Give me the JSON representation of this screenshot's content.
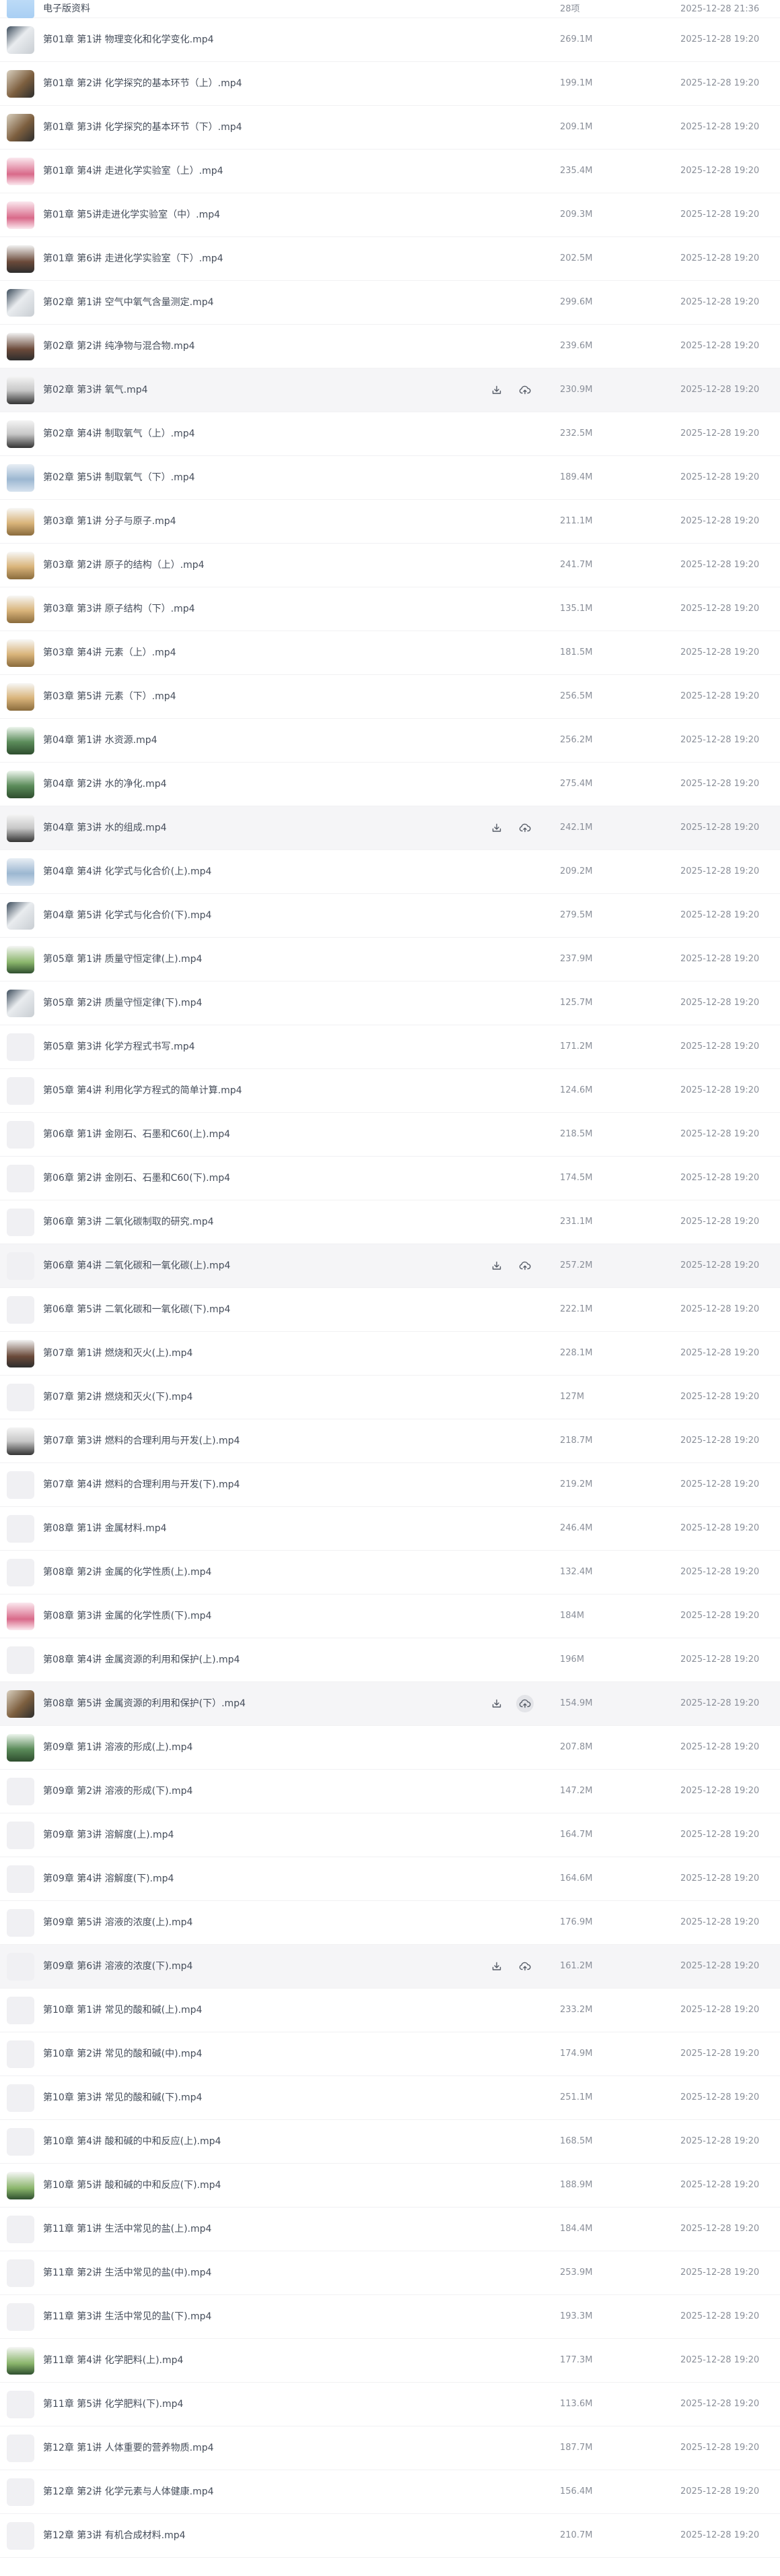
{
  "files": [
    {
      "name": "电子版资料",
      "size": "28项",
      "date": "2025-12-28 21:36",
      "thumb": "t-folder"
    },
    {
      "name": "第01章 第1讲 物理变化和化学变化.mp4",
      "size": "269.1M",
      "date": "2025-12-28 19:20",
      "thumb": "t-video-a"
    },
    {
      "name": "第01章 第2讲 化学探究的基本环节（上）.mp4",
      "size": "199.1M",
      "date": "2025-12-28 19:20",
      "thumb": "t-video-h"
    },
    {
      "name": "第01章 第3讲 化学探究的基本环节（下）.mp4",
      "size": "209.1M",
      "date": "2025-12-28 19:20",
      "thumb": "t-video-h"
    },
    {
      "name": "第01章 第4讲 走进化学实验室（上）.mp4",
      "size": "235.4M",
      "date": "2025-12-28 19:20",
      "thumb": "t-video-g"
    },
    {
      "name": "第01章 第5讲走进化学实验室（中）.mp4",
      "size": "209.3M",
      "date": "2025-12-28 19:20",
      "thumb": "t-video-g"
    },
    {
      "name": "第01章 第6讲 走进化学实验室（下）.mp4",
      "size": "202.5M",
      "date": "2025-12-28 19:20",
      "thumb": "t-video-b"
    },
    {
      "name": "第02章 第1讲 空气中氧气含量测定.mp4",
      "size": "299.6M",
      "date": "2025-12-28 19:20",
      "thumb": "t-video-a"
    },
    {
      "name": "第02章 第2讲 纯净物与混合物.mp4",
      "size": "239.6M",
      "date": "2025-12-28 19:20",
      "thumb": "t-video-b"
    },
    {
      "name": "第02章 第3讲 氧气.mp4",
      "size": "230.9M",
      "date": "2025-12-28 19:20",
      "thumb": "t-video-f"
    },
    {
      "name": "第02章 第4讲 制取氧气（上）.mp4",
      "size": "232.5M",
      "date": "2025-12-28 19:20",
      "thumb": "t-video-f"
    },
    {
      "name": "第02章 第5讲 制取氧气（下）.mp4",
      "size": "189.4M",
      "date": "2025-12-28 19:20",
      "thumb": "t-video-c"
    },
    {
      "name": "第03章 第1讲 分子与原子.mp4",
      "size": "211.1M",
      "date": "2025-12-28 19:20",
      "thumb": "t-video-d"
    },
    {
      "name": "第03章 第2讲 原子的结构（上）.mp4",
      "size": "241.7M",
      "date": "2025-12-28 19:20",
      "thumb": "t-video-d"
    },
    {
      "name": "第03章 第3讲 原子结构（下）.mp4",
      "size": "135.1M",
      "date": "2025-12-28 19:20",
      "thumb": "t-video-d"
    },
    {
      "name": "第03章 第4讲 元素（上）.mp4",
      "size": "181.5M",
      "date": "2025-12-28 19:20",
      "thumb": "t-video-d"
    },
    {
      "name": "第03章 第5讲 元素（下）.mp4",
      "size": "256.5M",
      "date": "2025-12-28 19:20",
      "thumb": "t-video-d"
    },
    {
      "name": "第04章 第1讲 水资源.mp4",
      "size": "256.2M",
      "date": "2025-12-28 19:20",
      "thumb": "t-video-e"
    },
    {
      "name": "第04章 第2讲 水的净化.mp4",
      "size": "275.4M",
      "date": "2025-12-28 19:20",
      "thumb": "t-video-e"
    },
    {
      "name": "第04章 第3讲 水的组成.mp4",
      "size": "242.1M",
      "date": "2025-12-28 19:20",
      "thumb": "t-video-f"
    },
    {
      "name": "第04章 第4讲 化学式与化合价(上).mp4",
      "size": "209.2M",
      "date": "2025-12-28 19:20",
      "thumb": "t-video-c"
    },
    {
      "name": "第04章 第5讲 化学式与化合价(下).mp4",
      "size": "279.5M",
      "date": "2025-12-28 19:20",
      "thumb": "t-video-a"
    },
    {
      "name": "第05章 第1讲 质量守恒定律(上).mp4",
      "size": "237.9M",
      "date": "2025-12-28 19:20",
      "thumb": "t-video-i"
    },
    {
      "name": "第05章 第2讲 质量守恒定律(下).mp4",
      "size": "125.7M",
      "date": "2025-12-28 19:20",
      "thumb": "t-video-a"
    },
    {
      "name": "第05章 第3讲 化学方程式书写.mp4",
      "size": "171.2M",
      "date": "2025-12-28 19:20",
      "thumb": "t-blank"
    },
    {
      "name": "第05章 第4讲 利用化学方程式的简单计算.mp4",
      "size": "124.6M",
      "date": "2025-12-28 19:20",
      "thumb": "t-blank"
    },
    {
      "name": "第06章 第1讲 金刚石、石墨和C60(上).mp4",
      "size": "218.5M",
      "date": "2025-12-28 19:20",
      "thumb": "t-blank"
    },
    {
      "name": "第06章 第2讲 金刚石、石墨和C60(下).mp4",
      "size": "174.5M",
      "date": "2025-12-28 19:20",
      "thumb": "t-blank"
    },
    {
      "name": "第06章 第3讲 二氧化碳制取的研究.mp4",
      "size": "231.1M",
      "date": "2025-12-28 19:20",
      "thumb": "t-blank"
    },
    {
      "name": "第06章 第4讲 二氧化碳和一氧化碳(上).mp4",
      "size": "257.2M",
      "date": "2025-12-28 19:20",
      "thumb": "t-blank"
    },
    {
      "name": "第06章 第5讲 二氧化碳和一氧化碳(下).mp4",
      "size": "222.1M",
      "date": "2025-12-28 19:20",
      "thumb": "t-blank"
    },
    {
      "name": "第07章 第1讲 燃烧和灭火(上).mp4",
      "size": "228.1M",
      "date": "2025-12-28 19:20",
      "thumb": "t-video-b"
    },
    {
      "name": "第07章 第2讲 燃烧和灭火(下).mp4",
      "size": "127M",
      "date": "2025-12-28 19:20",
      "thumb": "t-blank"
    },
    {
      "name": "第07章 第3讲 燃料的合理利用与开发(上).mp4",
      "size": "218.7M",
      "date": "2025-12-28 19:20",
      "thumb": "t-video-f"
    },
    {
      "name": "第07章 第4讲 燃料的合理利用与开发(下).mp4",
      "size": "219.2M",
      "date": "2025-12-28 19:20",
      "thumb": "t-blank"
    },
    {
      "name": "第08章 第1讲 金属材料.mp4",
      "size": "246.4M",
      "date": "2025-12-28 19:20",
      "thumb": "t-blank"
    },
    {
      "name": "第08章 第2讲 金属的化学性质(上).mp4",
      "size": "132.4M",
      "date": "2025-12-28 19:20",
      "thumb": "t-blank"
    },
    {
      "name": "第08章 第3讲 金属的化学性质(下).mp4",
      "size": "184M",
      "date": "2025-12-28 19:20",
      "thumb": "t-video-g"
    },
    {
      "name": "第08章 第4讲 金属资源的利用和保护(上).mp4",
      "size": "196M",
      "date": "2025-12-28 19:20",
      "thumb": "t-blank"
    },
    {
      "name": "第08章 第5讲 金属资源的利用和保护(下）.mp4",
      "size": "154.9M",
      "date": "2025-12-28 19:20",
      "thumb": "t-video-h"
    },
    {
      "name": "第09章 第1讲 溶液的形成(上).mp4",
      "size": "207.8M",
      "date": "2025-12-28 19:20",
      "thumb": "t-video-e"
    },
    {
      "name": "第09章 第2讲 溶液的形成(下).mp4",
      "size": "147.2M",
      "date": "2025-12-28 19:20",
      "thumb": "t-blank"
    },
    {
      "name": "第09章 第3讲 溶解度(上).mp4",
      "size": "164.7M",
      "date": "2025-12-28 19:20",
      "thumb": "t-blank"
    },
    {
      "name": "第09章 第4讲 溶解度(下).mp4",
      "size": "164.6M",
      "date": "2025-12-28 19:20",
      "thumb": "t-blank"
    },
    {
      "name": "第09章 第5讲 溶液的浓度(上).mp4",
      "size": "176.9M",
      "date": "2025-12-28 19:20",
      "thumb": "t-blank"
    },
    {
      "name": "第09章 第6讲 溶液的浓度(下).mp4",
      "size": "161.2M",
      "date": "2025-12-28 19:20",
      "thumb": "t-blank"
    },
    {
      "name": "第10章 第1讲 常见的酸和碱(上).mp4",
      "size": "233.2M",
      "date": "2025-12-28 19:20",
      "thumb": "t-blank"
    },
    {
      "name": "第10章 第2讲 常见的酸和碱(中).mp4",
      "size": "174.9M",
      "date": "2025-12-28 19:20",
      "thumb": "t-blank"
    },
    {
      "name": "第10章 第3讲 常见的酸和碱(下).mp4",
      "size": "251.1M",
      "date": "2025-12-28 19:20",
      "thumb": "t-blank"
    },
    {
      "name": "第10章 第4讲 酸和碱的中和反应(上).mp4",
      "size": "168.5M",
      "date": "2025-12-28 19:20",
      "thumb": "t-blank"
    },
    {
      "name": "第10章 第5讲 酸和碱的中和反应(下).mp4",
      "size": "188.9M",
      "date": "2025-12-28 19:20",
      "thumb": "t-video-i"
    },
    {
      "name": "第11章 第1讲 生活中常见的盐(上).mp4",
      "size": "184.4M",
      "date": "2025-12-28 19:20",
      "thumb": "t-blank"
    },
    {
      "name": "第11章 第2讲 生活中常见的盐(中).mp4",
      "size": "253.9M",
      "date": "2025-12-28 19:20",
      "thumb": "t-blank"
    },
    {
      "name": "第11章 第3讲 生活中常见的盐(下).mp4",
      "size": "193.3M",
      "date": "2025-12-28 19:20",
      "thumb": "t-blank"
    },
    {
      "name": "第11章 第4讲 化学肥料(上).mp4",
      "size": "177.3M",
      "date": "2025-12-28 19:20",
      "thumb": "t-video-i"
    },
    {
      "name": "第11章 第5讲 化学肥料(下).mp4",
      "size": "113.6M",
      "date": "2025-12-28 19:20",
      "thumb": "t-blank"
    },
    {
      "name": "第12章 第1讲 人体重要的营养物质.mp4",
      "size": "187.7M",
      "date": "2025-12-28 19:20",
      "thumb": "t-blank"
    },
    {
      "name": "第12章 第2讲 化学元素与人体健康.mp4",
      "size": "156.4M",
      "date": "2025-12-28 19:20",
      "thumb": "t-blank"
    },
    {
      "name": "第12章 第3讲 有机合成材料.mp4",
      "size": "210.7M",
      "date": "2025-12-28 19:20",
      "thumb": "t-blank"
    }
  ],
  "hover_rows": [
    9,
    19,
    29,
    39,
    45
  ],
  "active_save_rows": [
    39
  ],
  "icons": {
    "download": "download-icon",
    "save": "cloud-save-icon"
  },
  "colors": {
    "row_hover": "#f5f5f7",
    "text": "#454d5a",
    "meta": "#8a8f99",
    "divider": "#f1f1f3",
    "icon": "#555b66"
  }
}
